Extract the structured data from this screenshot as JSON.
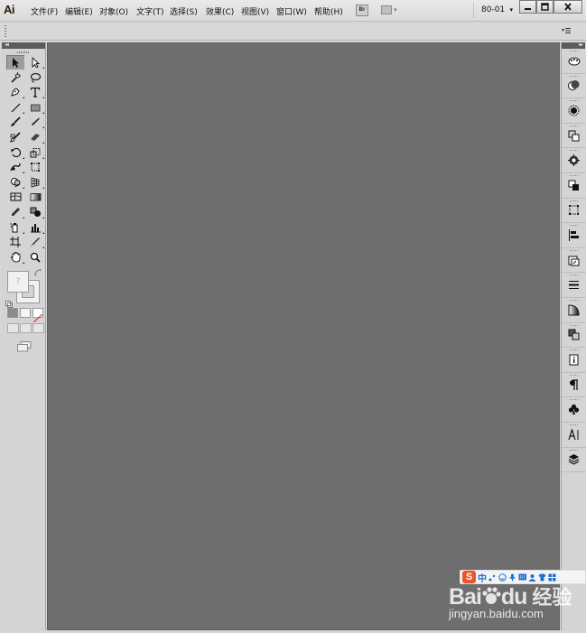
{
  "app": {
    "logo": "Ai"
  },
  "menu": {
    "items": [
      {
        "label": "文件(F)"
      },
      {
        "label": "编辑(E)"
      },
      {
        "label": "对象(O)"
      },
      {
        "label": "文字(T)"
      },
      {
        "label": "选择(S)"
      },
      {
        "label": "效果(C)"
      },
      {
        "label": "视图(V)"
      },
      {
        "label": "窗口(W)"
      },
      {
        "label": "帮助(H)"
      }
    ],
    "bridge_label": "Br",
    "workspace": "80-01",
    "workspace_caret": "▾"
  },
  "icons": {
    "title_bar": [
      "app-logo-icon",
      "bridge-icon",
      "arrange-documents-icon",
      "minimize-icon",
      "maximize-icon",
      "close-icon"
    ],
    "tools": [
      "selection-tool-icon",
      "direct-selection-tool-icon",
      "magic-wand-tool-icon",
      "lasso-tool-icon",
      "pen-tool-icon",
      "type-tool-icon",
      "line-segment-tool-icon",
      "rectangle-tool-icon",
      "paintbrush-tool-icon",
      "pencil-tool-icon",
      "blob-brush-tool-icon",
      "eraser-tool-icon",
      "rotate-tool-icon",
      "scale-tool-icon",
      "warp-tool-icon",
      "free-transform-tool-icon",
      "shape-builder-tool-icon",
      "perspective-grid-tool-icon",
      "mesh-tool-icon",
      "gradient-tool-icon",
      "eyedropper-tool-icon",
      "blend-tool-icon",
      "symbol-sprayer-tool-icon",
      "column-graph-tool-icon",
      "artboard-tool-icon",
      "slice-tool-icon",
      "hand-tool-icon",
      "zoom-tool-icon"
    ],
    "dock": [
      "color-guide-icon",
      "color-icon",
      "appearance-icon",
      "transform-icon",
      "brushes-icon",
      "pathfinder-icon",
      "transform-bounds-icon",
      "align-icon",
      "artboards-icon",
      "stroke-icon",
      "gradient-icon",
      "transparency-icon",
      "document-info-icon",
      "paragraph-icon",
      "symbols-icon",
      "character-icon",
      "layers-icon"
    ]
  },
  "toolbar": {
    "fill_placeholder": "?"
  },
  "watermark": {
    "ime_s": "S",
    "ime_zh": "中",
    "logo_a": "Bai",
    "logo_b": "du",
    "logo_jy": "经验",
    "url": "jingyan.baidu.com"
  },
  "colors": {
    "canvas": "#6e6e6e",
    "chrome": "#d6d6d6",
    "panel_header": "#5b5b5b",
    "no_fill_red": "#e3342f",
    "ime_orange": "#e8562a",
    "ime_blue": "#1c6fd4"
  }
}
